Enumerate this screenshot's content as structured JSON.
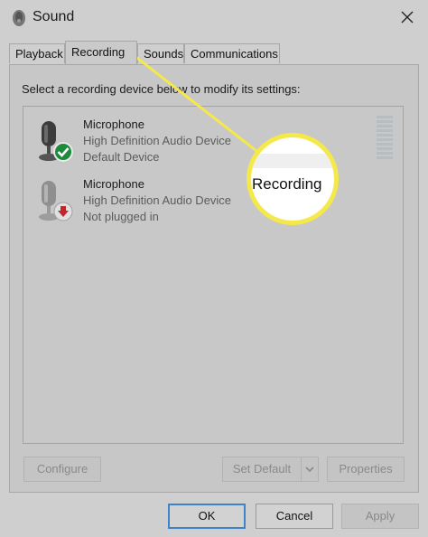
{
  "window": {
    "title": "Sound",
    "close_icon": "close-icon",
    "app_icon": "speaker-icon"
  },
  "tabs": [
    {
      "label": "Playback",
      "active": false
    },
    {
      "label": "Recording",
      "active": true
    },
    {
      "label": "Sounds",
      "active": false
    },
    {
      "label": "Communications",
      "active": false
    }
  ],
  "instruction": "Select a recording device below to modify its settings:",
  "devices": [
    {
      "name": "Microphone",
      "driver": "High Definition Audio Device",
      "status": "Default Device",
      "badge": "green-check-icon",
      "badge_color": "#1e8a3c"
    },
    {
      "name": "Microphone",
      "driver": "High Definition Audio Device",
      "status": "Not plugged in",
      "badge": "red-down-arrow-icon",
      "badge_color": "#c0272d"
    }
  ],
  "buttons": {
    "configure": "Configure",
    "set_default": "Set Default",
    "properties": "Properties",
    "ok": "OK",
    "cancel": "Cancel",
    "apply": "Apply"
  },
  "callout": {
    "text": "Recording",
    "color": "#f5e94a"
  }
}
